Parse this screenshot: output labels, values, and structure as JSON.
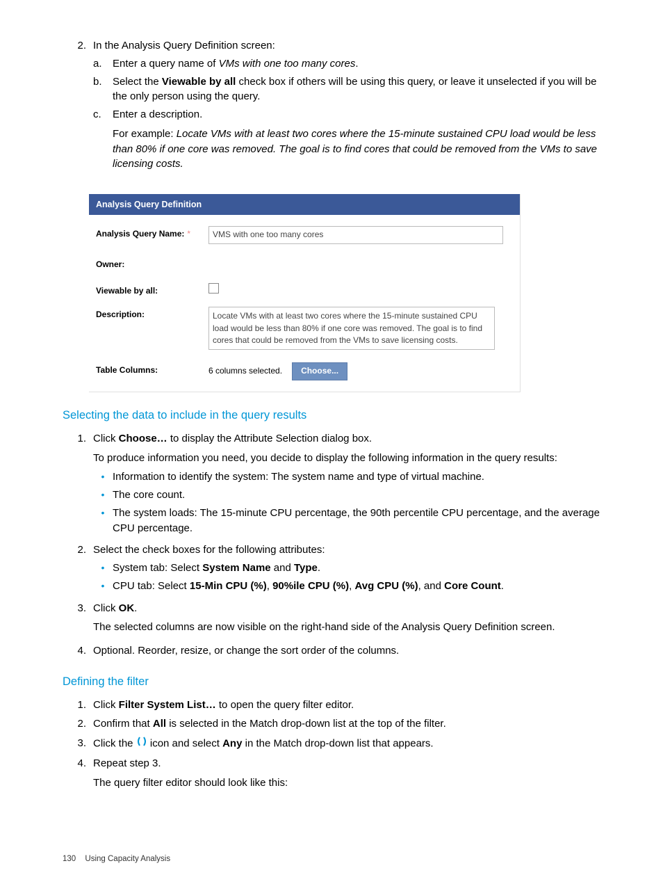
{
  "step2": {
    "num": "2.",
    "lead": "In the Analysis Query Definition screen:",
    "a_n": "a.",
    "a_pre": "Enter a query name of ",
    "a_ital": "VMs with one too many cores",
    "a_post": ".",
    "b_n": "b.",
    "b_pre": "Select the ",
    "b_bold": "Viewable by all",
    "b_post": " check box if others will be using this query, or leave it unselected if you will be the only person using the query.",
    "c_n": "c.",
    "c_text": "Enter a description.",
    "c_para_pre": "For example: ",
    "c_para_ital": "Locate VMs with at least two cores where the 15-minute sustained CPU load would be less than 80% if one core was removed. The goal is to find cores that could be removed from the VMs to save licensing costs."
  },
  "form": {
    "header": "Analysis Query Definition",
    "qname_label": "Analysis Query Name:",
    "qname_value": "VMS with one too many cores",
    "owner_label": "Owner:",
    "view_label": "Viewable by all:",
    "desc_label": "Description:",
    "desc_value": "Locate VMs with at least two cores where the 15-minute sustained CPU load would be less than 80% if one core was removed. The goal is to find cores that could be removed from the VMs to save licensing costs.",
    "cols_label": "Table Columns:",
    "cols_text": "6 columns selected.",
    "choose_btn": "Choose..."
  },
  "sec1": {
    "title": "Selecting the data to include in the query results",
    "s1_n": "1.",
    "s1_pre": "Click ",
    "s1_bold": "Choose…",
    "s1_post": " to display the Attribute Selection dialog box.",
    "s1_para": "To produce information you need, you decide to display the following information in the query results:",
    "b1": "Information to identify the system: The system name and type of virtual machine.",
    "b2": "The core count.",
    "b3": "The system loads: The 15-minute CPU percentage, the 90th percentile CPU percentage, and the average CPU percentage.",
    "s2_n": "2.",
    "s2_text": "Select the check boxes for the following attributes:",
    "s2b1_pre": "System tab: Select ",
    "s2b1_b1": "System Name",
    "s2b1_mid": " and ",
    "s2b1_b2": "Type",
    "s2b1_post": ".",
    "s2b2_pre": "CPU tab: Select ",
    "s2b2_b1": "15-Min CPU (%)",
    "s2b2_m1": ", ",
    "s2b2_b2": "90%ile CPU (%)",
    "s2b2_m2": ", ",
    "s2b2_b3": "Avg CPU (%)",
    "s2b2_m3": ", and ",
    "s2b2_b4": "Core Count",
    "s2b2_post": ".",
    "s3_n": "3.",
    "s3_pre": "Click ",
    "s3_bold": "OK",
    "s3_post": ".",
    "s3_para": "The selected columns are now visible on the right-hand side of the Analysis Query Definition screen.",
    "s4_n": "4.",
    "s4_text": "Optional. Reorder, resize, or change the sort order of the columns."
  },
  "sec2": {
    "title": "Defining the filter",
    "s1_n": "1.",
    "s1_pre": "Click ",
    "s1_bold": "Filter System List…",
    "s1_post": " to open the query filter editor.",
    "s2_n": "2.",
    "s2_pre": "Confirm that ",
    "s2_bold": "All",
    "s2_post": " is selected in the Match drop-down list at the top of the filter.",
    "s3_n": "3.",
    "s3_pre": "Click the ",
    "s3_mid": " icon and select ",
    "s3_bold": "Any",
    "s3_post": " in the Match drop-down list that appears.",
    "s4_n": "4.",
    "s4_text": "Repeat step 3.",
    "s4_para": "The query filter editor should look like this:"
  },
  "footer": {
    "page": "130",
    "chapter": "Using Capacity Analysis"
  }
}
